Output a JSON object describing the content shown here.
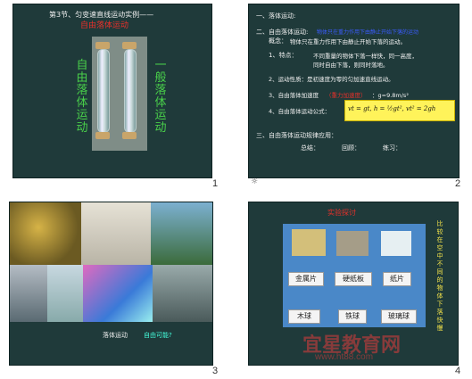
{
  "slide1": {
    "title_line": "第3节、匀变速直线运动实例——",
    "title_red": "自由落体运动",
    "left_label": "自由落体运动",
    "right_label": "一般落体运动",
    "number": "1"
  },
  "slide2": {
    "heading1": "一、落体运动:",
    "heading2": "二、自由落体运动:",
    "red_note": "物体只在重力作用下由静止开始下落的运动",
    "concept_label": "概念：",
    "concept_text": "物体只在重力作用下由静止开始下落的运动。",
    "p1_label": "1、特点：",
    "p1_line1": "不同重量的物体下落一样快，同一高度，",
    "p1_line2": "同时自由下落，则同时落地。",
    "p2": "2、运动性质：是初速度为零的匀加速直线运动。",
    "p3_label": "3、自由落体加速度",
    "p3_red": "（重力加速度）",
    "p3_value": "：g=9.8m/s²",
    "p4": "4、自由落体运动公式：",
    "formula": "vt = gt,  h = ½gt²,  vt² = 2gh",
    "h3": "三、自由落体运动规律应用：",
    "app1": "总结：",
    "app2": "回顾：",
    "app3": "练习：",
    "number": "2"
  },
  "slide3": {
    "caption1": "落体运动",
    "caption2": "自由可能?",
    "number": "3"
  },
  "slide4": {
    "title": "实验探讨",
    "card1": "金属片",
    "card2": "硬纸板",
    "card3": "纸片",
    "card4": "木球",
    "card5": "铁球",
    "card6": "玻璃球",
    "side_text": "比较在空中不同的物体下落快慢",
    "watermark": "宜星教育网",
    "watermark_url": "www.ht88.com",
    "number": "4"
  },
  "colors": {
    "bg": "#1f3a3a",
    "accent_red": "#e8302a",
    "green": "#49d04a",
    "yellow": "#f3e24a"
  }
}
